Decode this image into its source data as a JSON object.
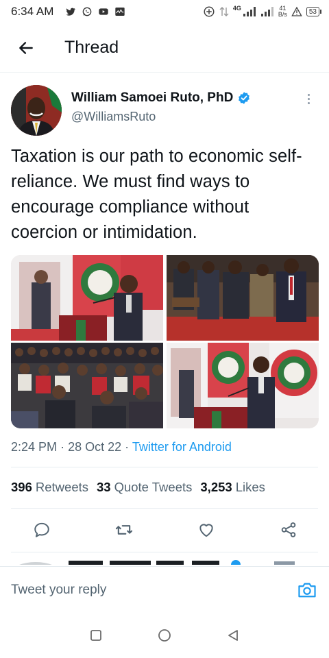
{
  "status_bar": {
    "time": "6:34 AM",
    "network_type": "4G",
    "speed_value": "41",
    "speed_unit": "B/s",
    "battery": "53",
    "left_icons": [
      "twitter-icon",
      "whatsapp-icon",
      "youtube-icon",
      "activity-icon"
    ],
    "right_icons": [
      "add-circle-icon",
      "data-arrows-icon",
      "signal-icon",
      "signal-icon",
      "warning-icon",
      "battery-icon"
    ]
  },
  "header": {
    "title": "Thread",
    "back_icon": "arrow-left-icon"
  },
  "tweet": {
    "author_name": "William Samoei Ruto, PhD",
    "author_handle": "@WilliamsRuto",
    "verified": true,
    "text": "Taxation is our path to economic self-reliance. We must find ways to encourage compliance without coercion or intimidation.",
    "time": "2:24 PM",
    "date": "28 Oct 22",
    "separator": "·",
    "source": "Twitter for Android",
    "media_count": 4
  },
  "stats": {
    "retweets_count": "396",
    "retweets_label": "Retweets",
    "quotes_count": "33",
    "quotes_label": "Quote Tweets",
    "likes_count": "3,253",
    "likes_label": "Likes"
  },
  "actions": [
    "reply-icon",
    "retweet-icon",
    "like-icon",
    "share-icon"
  ],
  "reply_bar": {
    "placeholder": "Tweet your reply",
    "camera_icon": "camera-icon"
  },
  "nav": [
    "recents-icon",
    "home-icon",
    "back-icon"
  ],
  "colors": {
    "accent": "#1d9bf0",
    "text": "#0f1419",
    "secondary": "#536471",
    "divider": "#e6ecf0"
  }
}
